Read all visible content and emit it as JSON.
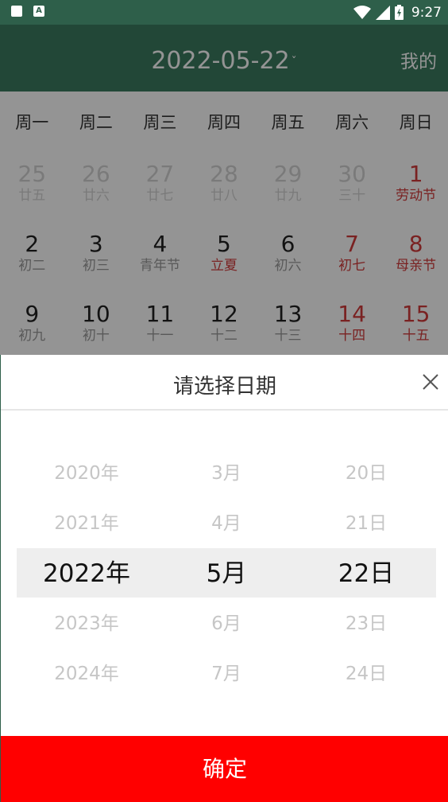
{
  "status_bar": {
    "time": "9:27",
    "left_icons": [
      "sim-card-icon",
      "font-a-icon"
    ],
    "left_badge_text": "A",
    "right_icons": [
      "wifi-icon",
      "cellular-signal-icon",
      "battery-charging-icon"
    ]
  },
  "header": {
    "date": "2022-05-22",
    "dropdown_glyph": "ˇ",
    "mine": "我的",
    "color": "#3c7a60"
  },
  "calendar": {
    "weekdays": [
      "周一",
      "周二",
      "周三",
      "周四",
      "周五",
      "周六",
      "周日"
    ],
    "rows": [
      [
        {
          "num": "25",
          "sub": "廿五",
          "style": "muted"
        },
        {
          "num": "26",
          "sub": "廿六",
          "style": "muted"
        },
        {
          "num": "27",
          "sub": "廿七",
          "style": "muted"
        },
        {
          "num": "28",
          "sub": "廿八",
          "style": "muted"
        },
        {
          "num": "29",
          "sub": "廿九",
          "style": "muted"
        },
        {
          "num": "30",
          "sub": "三十",
          "style": "muted"
        },
        {
          "num": "1",
          "sub": "劳动节",
          "style": "red"
        }
      ],
      [
        {
          "num": "2",
          "sub": "初二",
          "style": ""
        },
        {
          "num": "3",
          "sub": "初三",
          "style": ""
        },
        {
          "num": "4",
          "sub": "青年节",
          "style": ""
        },
        {
          "num": "5",
          "sub": "立夏",
          "style": "redsub"
        },
        {
          "num": "6",
          "sub": "初六",
          "style": ""
        },
        {
          "num": "7",
          "sub": "初七",
          "style": "red"
        },
        {
          "num": "8",
          "sub": "母亲节",
          "style": "red"
        }
      ],
      [
        {
          "num": "9",
          "sub": "初九",
          "style": ""
        },
        {
          "num": "10",
          "sub": "初十",
          "style": ""
        },
        {
          "num": "11",
          "sub": "十一",
          "style": ""
        },
        {
          "num": "12",
          "sub": "十二",
          "style": ""
        },
        {
          "num": "13",
          "sub": "十三",
          "style": ""
        },
        {
          "num": "14",
          "sub": "十四",
          "style": "red"
        },
        {
          "num": "15",
          "sub": "十五",
          "style": "red"
        }
      ]
    ]
  },
  "sheet": {
    "title": "请选择日期",
    "close_icon": "close-icon",
    "years": [
      "2020年",
      "2021年",
      "2022年",
      "2023年",
      "2024年"
    ],
    "months": [
      "3月",
      "4月",
      "5月",
      "6月",
      "7月"
    ],
    "days": [
      "20日",
      "21日",
      "22日",
      "23日",
      "24日"
    ],
    "selected_index": 2,
    "confirm": "确定",
    "confirm_color": "#ff0000"
  }
}
